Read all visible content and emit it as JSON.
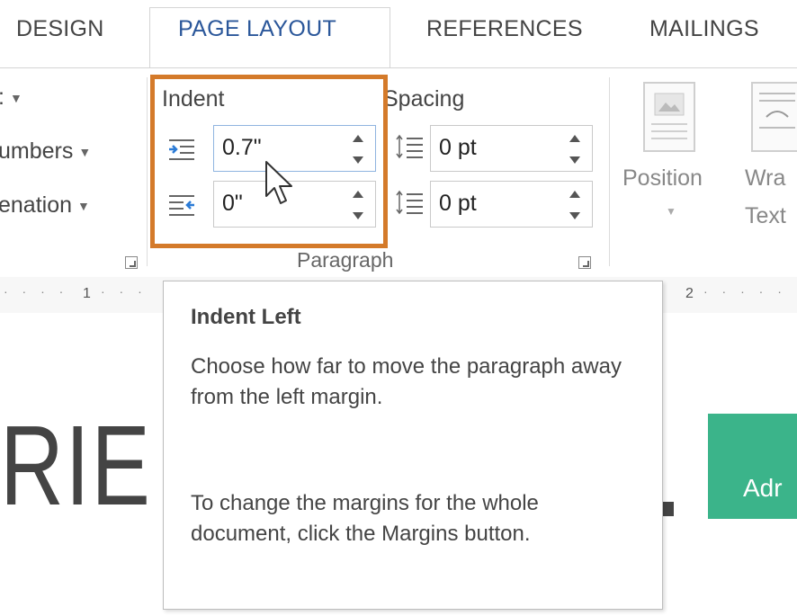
{
  "tabs": [
    {
      "label": "DESIGN",
      "active": false
    },
    {
      "label": "PAGE LAYOUT",
      "active": true
    },
    {
      "label": "REFERENCES",
      "active": false
    },
    {
      "label": "MAILINGS",
      "active": false
    }
  ],
  "left_group": {
    "row1": ":",
    "row2": "umbers",
    "row3": "enation"
  },
  "paragraph_group": {
    "label": "Paragraph",
    "indent": {
      "heading": "Indent",
      "left_value": "0.7\"",
      "right_value": "0\""
    },
    "spacing": {
      "heading": "Spacing",
      "before_value": "0 pt",
      "after_value": "0 pt"
    }
  },
  "arrange_group": {
    "position_label": "Position",
    "wrap_label_line1": "Wra",
    "wrap_label_line2": "Text"
  },
  "ruler": {
    "mark1": "1",
    "mark2": "2"
  },
  "document": {
    "heading_fragment": "RIE",
    "button_fragment": "Adr"
  },
  "tooltip": {
    "title": "Indent Left",
    "description": "Choose how far to move the paragraph away from the left margin.",
    "hint": "To change the margins for the whole document, click the Margins button."
  },
  "colors": {
    "highlight_border": "#d47a2a",
    "active_tab_text": "#2b579a",
    "green_button": "#3bb48a"
  }
}
